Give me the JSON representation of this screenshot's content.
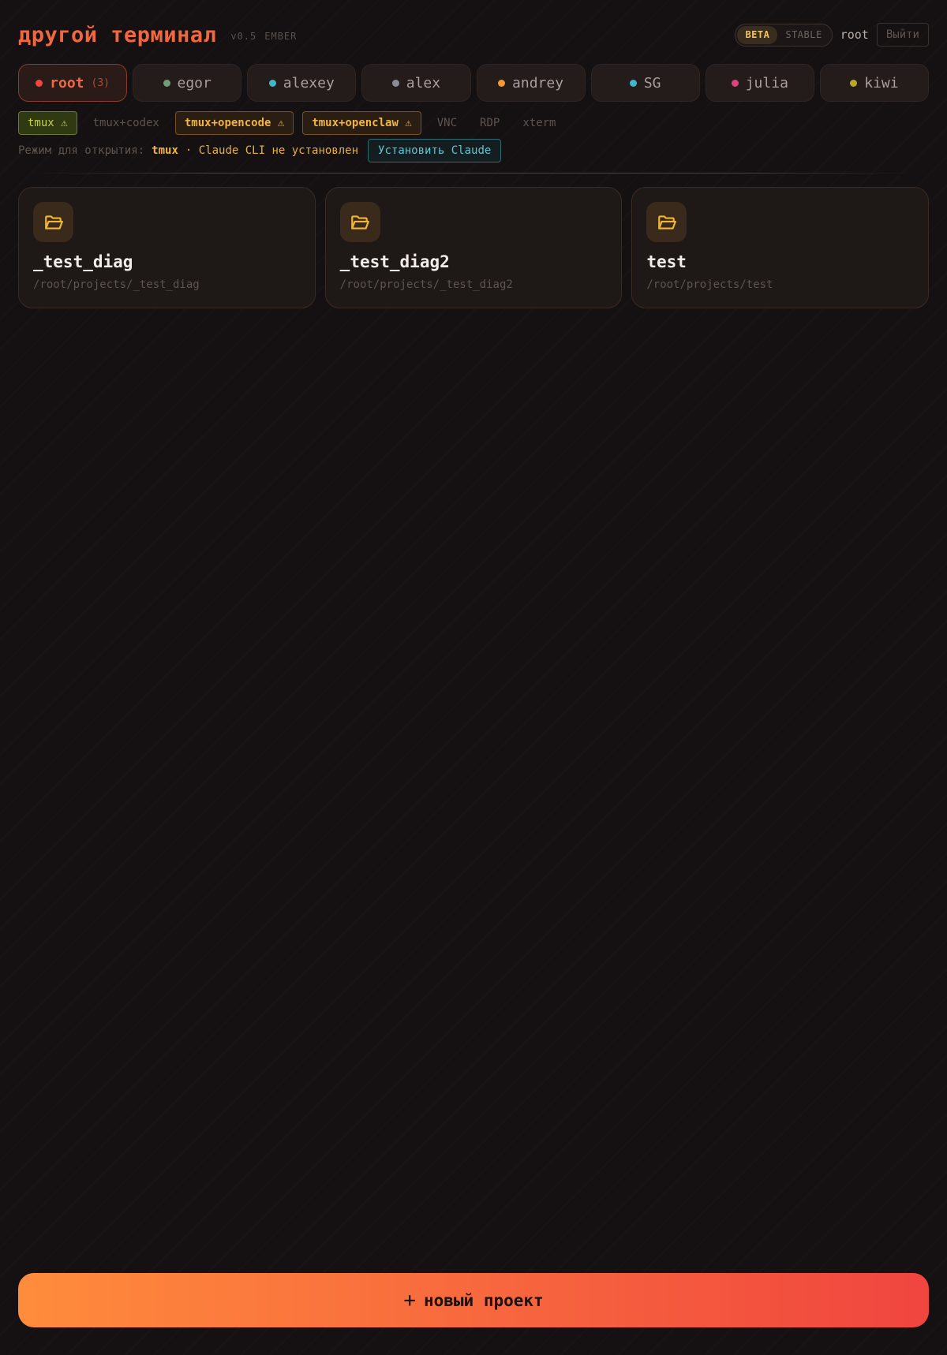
{
  "header": {
    "brand": "другой терминал",
    "version": "v0.5",
    "edition": "EMBER",
    "channels": [
      {
        "label": "BETA",
        "active": true
      },
      {
        "label": "STABLE",
        "active": false
      }
    ],
    "user": "root",
    "logout_label": "Выйти"
  },
  "users": [
    {
      "name": "root",
      "count": "(3)",
      "color": "#f0483f",
      "active": true
    },
    {
      "name": "egor",
      "color": "#6f9e78",
      "active": false
    },
    {
      "name": "alexey",
      "color": "#3fb7c9",
      "active": false
    },
    {
      "name": "alex",
      "color": "#8c8a96",
      "active": false
    },
    {
      "name": "andrey",
      "color": "#f29a2e",
      "active": false
    },
    {
      "name": "SG",
      "color": "#3fb7c9",
      "active": false
    },
    {
      "name": "julia",
      "color": "#e0417a",
      "active": false
    },
    {
      "name": "kiwi",
      "color": "#b8a82a",
      "active": false
    }
  ],
  "modes": [
    {
      "label": "tmux ⚠",
      "style": "green"
    },
    {
      "label": "tmux+codex",
      "style": "plain"
    },
    {
      "label": "tmux+opencode ⚠",
      "style": "warn"
    },
    {
      "label": "tmux+openclaw ⚠",
      "style": "warn"
    },
    {
      "label": "VNC",
      "style": "plain"
    },
    {
      "label": "RDP",
      "style": "plain"
    },
    {
      "label": "xterm",
      "style": "plain"
    }
  ],
  "status": {
    "label": "Режим для открытия:",
    "mode": "tmux",
    "warning": "· Claude CLI не установлен",
    "install_label": "Установить Claude"
  },
  "projects": [
    {
      "name": "_test_diag",
      "path": "/root/projects/_test_diag",
      "icon": "folder-open-icon"
    },
    {
      "name": "_test_diag2",
      "path": "/root/projects/_test_diag2",
      "icon": "folder-open-icon"
    },
    {
      "name": "test",
      "path": "/root/projects/test",
      "icon": "folder-open-icon"
    }
  ],
  "new_project": {
    "icon": "+",
    "label": "новый проект"
  }
}
